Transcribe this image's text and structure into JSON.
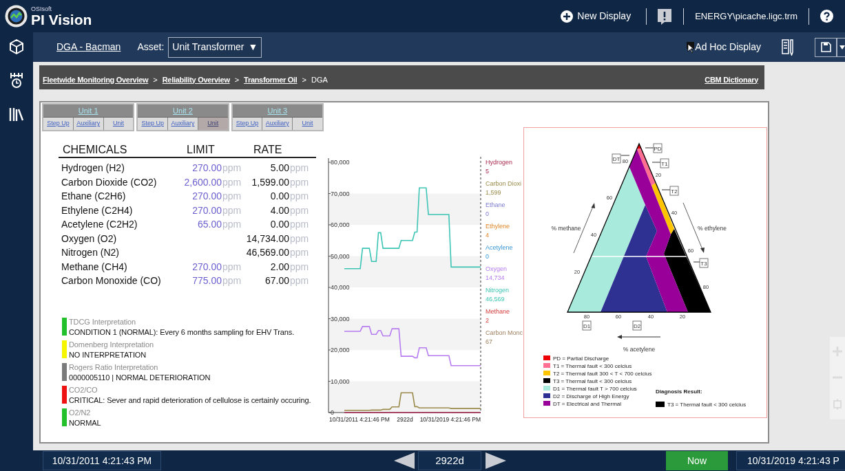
{
  "header": {
    "brand_small": "OSIsoft",
    "brand": "PI Vision",
    "new_display": "New Display",
    "user": "ENERGY\\picache.ligc.trm"
  },
  "toolbar": {
    "display_name": "DGA - Bacman",
    "asset_label": "Asset:",
    "asset_value": "Unit Transformer",
    "asset_caret": "▼",
    "ad_hoc": "Ad Hoc Display"
  },
  "breadcrumb": {
    "items": [
      {
        "kind": "link",
        "text": "Fleetwide Monitoring Overview"
      },
      {
        "kind": "separator",
        "text": ">"
      },
      {
        "kind": "link",
        "text": "Reliability Overview"
      },
      {
        "kind": "separator",
        "text": ">"
      },
      {
        "kind": "link",
        "text": "Transformer Oil"
      },
      {
        "kind": "separator",
        "text": ">"
      },
      {
        "kind": "current",
        "text": "DGA"
      }
    ],
    "dictionary_link": "CBM Dictionary"
  },
  "unit_tabs": [
    {
      "label": "Unit 1",
      "buttons": [
        {
          "label": "Step Up",
          "selected": false
        },
        {
          "label": "Auxiliary",
          "selected": false
        },
        {
          "label": "Unit",
          "selected": false
        }
      ]
    },
    {
      "label": "Unit 2",
      "buttons": [
        {
          "label": "Step Up",
          "selected": false
        },
        {
          "label": "Auxiliary",
          "selected": false
        },
        {
          "label": "Unit",
          "selected": true
        }
      ]
    },
    {
      "label": "Unit 3",
      "buttons": [
        {
          "label": "Step Up",
          "selected": false
        },
        {
          "label": "Auxiliary",
          "selected": false
        },
        {
          "label": "Unit",
          "selected": false
        }
      ]
    }
  ],
  "chemicals": {
    "columns": [
      "CHEMICALS",
      "LIMIT",
      "RATE"
    ],
    "rows": [
      {
        "name": "Hydrogen (H2)",
        "limit": "270.00",
        "limit_unit": "ppm",
        "rate": "5.00",
        "rate_unit": "ppm"
      },
      {
        "name": "Carbon Dioxide (CO2)",
        "limit": "2,600.00",
        "limit_unit": "ppm",
        "rate": "1,599.00",
        "rate_unit": "ppm"
      },
      {
        "name": "Ethane (C2H6)",
        "limit": "270.00",
        "limit_unit": "ppm",
        "rate": "0.00",
        "rate_unit": "ppm"
      },
      {
        "name": "Ethylene (C2H4)",
        "limit": "270.00",
        "limit_unit": "ppm",
        "rate": "4.00",
        "rate_unit": "ppm"
      },
      {
        "name": "Acetylene (C2H2)",
        "limit": "65.00",
        "limit_unit": "ppm",
        "rate": "0.00",
        "rate_unit": "ppm"
      },
      {
        "name": "Oxygen (O2)",
        "rate": "14,734.00",
        "rate_unit": "ppm"
      },
      {
        "name": "Nitrogen (N2)",
        "rate": "46,569.00",
        "rate_unit": "ppm"
      },
      {
        "name": "Methane (CH4)",
        "limit": "270.00",
        "limit_unit": "ppm",
        "rate": "2.00",
        "rate_unit": "ppm"
      },
      {
        "name": "Carbon Monoxide (CO)",
        "limit": "775.00",
        "limit_unit": "ppm",
        "rate": "67.00",
        "rate_unit": "ppm"
      }
    ]
  },
  "interpretations": [
    {
      "title": "TDCG Interpretation",
      "text": "CONDITION 1 (NORMAL): Every 6 months sampling for EHV Trans.",
      "color": "#22c02a"
    },
    {
      "title": "Domenberg Interpretation",
      "text": "NO INTERPRETATION",
      "color": "#f5f500"
    },
    {
      "title": "Rogers Ratio Interpretation",
      "text": "0000005110 | NORMAL DETERIORATION",
      "color": "#7a7a7a"
    },
    {
      "title": "CO2/CO",
      "text": "CRITICAL: Sever and rapid deterioration of cellulose is certainly occuring.",
      "color": "#ee1111"
    },
    {
      "title": "O2/N2",
      "text": "NORMAL",
      "color": "#22c02a"
    }
  ],
  "trend": {
    "chart_data": {
      "type": "line",
      "categories": [
        null,
        null,
        null,
        null,
        null,
        null,
        null,
        null,
        null,
        null,
        null,
        null,
        null,
        null,
        null,
        null,
        null,
        null,
        null,
        null,
        null,
        null,
        null,
        null,
        null,
        null,
        null,
        null,
        null,
        null,
        null,
        null,
        null,
        null,
        null,
        null,
        null,
        null,
        null,
        null,
        null,
        null,
        null,
        null,
        null,
        null,
        null,
        null,
        null,
        null,
        null,
        null,
        null,
        null,
        null,
        null,
        null,
        null,
        null,
        null,
        null
      ],
      "ylim": [
        0,
        80000
      ],
      "yticks": [
        {
          "value": 0,
          "label": "0"
        },
        {
          "value": 10000,
          "label": "10,000"
        },
        {
          "value": 20000,
          "label": "20,000"
        },
        {
          "value": 30000,
          "label": "30,000"
        },
        {
          "value": 40000,
          "label": "40,000"
        },
        {
          "value": 50000,
          "label": "50,000"
        },
        {
          "value": 60000,
          "label": "60,000"
        },
        {
          "value": 70000,
          "label": "70,000"
        },
        {
          "value": 80000,
          "label": "80,000"
        }
      ],
      "series": [
        {
          "name": "Hydrogen",
          "color": "#a8284f",
          "values": [
            5,
            5,
            5,
            5,
            5,
            5,
            5,
            5,
            5,
            5,
            5,
            5,
            5,
            5,
            5,
            5,
            5,
            5,
            5,
            5,
            5,
            5,
            5,
            5,
            5,
            5,
            5,
            5,
            5,
            5,
            5,
            5,
            5,
            5,
            5,
            5,
            5,
            5,
            5,
            5,
            5,
            5,
            5,
            5,
            5,
            5,
            5,
            5,
            5,
            5,
            5,
            5,
            5,
            5,
            5,
            5,
            5,
            5,
            5,
            5,
            5
          ]
        },
        {
          "name": "Carbon Dioxi",
          "color": "#9a8a4a",
          "values": [
            700,
            700,
            700,
            700,
            700,
            700,
            700,
            700,
            700,
            700,
            700,
            700,
            800,
            800,
            800,
            800,
            800,
            1000,
            1000,
            1000,
            1000,
            1800,
            1800,
            1800,
            1800,
            6300,
            6300,
            6300,
            6300,
            6300,
            6300,
            1900,
            1900,
            1500,
            1500,
            1500,
            1500,
            1500,
            1500,
            1500,
            1500,
            1500,
            1500,
            1500,
            1500,
            1500,
            1500,
            1300,
            1300,
            1300,
            1300,
            1300,
            1300,
            1300,
            1300,
            1300,
            1300,
            1300,
            1300,
            1300,
            1300
          ]
        },
        {
          "name": "Ethane",
          "color": "#7b7bd0",
          "values": [
            null,
            null,
            null,
            null,
            null,
            null,
            null,
            null,
            null,
            null,
            null,
            null,
            null,
            null,
            null,
            null,
            null,
            null,
            null,
            null,
            null,
            null,
            null,
            null,
            null,
            null,
            null,
            null,
            null,
            null,
            null,
            null,
            null,
            null,
            null,
            null,
            null,
            null,
            null,
            null,
            null,
            null,
            null,
            null,
            null,
            null,
            null,
            null,
            null,
            null,
            null,
            null,
            null,
            null,
            null,
            null,
            null,
            null,
            null,
            null,
            null
          ]
        },
        {
          "name": "Ethylene",
          "color": "#e0862a",
          "values": [
            null,
            null,
            null,
            null,
            null,
            null,
            null,
            null,
            null,
            null,
            null,
            null,
            null,
            null,
            null,
            null,
            null,
            null,
            null,
            null,
            null,
            null,
            null,
            null,
            null,
            null,
            null,
            null,
            null,
            null,
            null,
            null,
            null,
            null,
            null,
            null,
            null,
            null,
            null,
            null,
            null,
            null,
            null,
            null,
            null,
            null,
            null,
            null,
            null,
            null,
            null,
            null,
            null,
            null,
            null,
            null,
            null,
            null,
            null,
            null,
            null
          ]
        },
        {
          "name": "Acetylene",
          "color": "#3a98d8",
          "values": [
            null,
            null,
            null,
            null,
            null,
            null,
            null,
            null,
            null,
            null,
            null,
            null,
            null,
            null,
            null,
            null,
            null,
            null,
            null,
            null,
            null,
            null,
            null,
            null,
            null,
            null,
            null,
            null,
            null,
            null,
            null,
            null,
            null,
            null,
            null,
            null,
            null,
            null,
            null,
            null,
            null,
            null,
            null,
            null,
            null,
            null,
            null,
            null,
            null,
            null,
            null,
            null,
            null,
            null,
            null,
            null,
            null,
            null,
            null,
            null,
            null
          ]
        },
        {
          "name": "Oxygen",
          "color": "#b67cf0",
          "values": [
            26000,
            26000,
            26000,
            26000,
            26000,
            26000,
            26000,
            26000,
            27500,
            27500,
            27500,
            27500,
            25000,
            25000,
            25000,
            26200,
            26200,
            24500,
            24500,
            24500,
            24500,
            26800,
            26800,
            26800,
            26800,
            18000,
            18000,
            18000,
            18000,
            18000,
            18000,
            17500,
            17500,
            20700,
            20700,
            20700,
            20700,
            18200,
            18200,
            18200,
            18200,
            18200,
            18200,
            18200,
            18200,
            18200,
            18200,
            15000,
            15000,
            15000,
            15000,
            15000,
            15000,
            15000,
            15000,
            15000,
            15000,
            15000,
            15000,
            15000,
            15000
          ]
        },
        {
          "name": "Nitrogen",
          "color": "#3cc4b4",
          "values": [
            46000,
            46000,
            46000,
            46000,
            46000,
            46000,
            46000,
            46000,
            52500,
            52500,
            52500,
            52500,
            48300,
            48300,
            48300,
            57500,
            57500,
            52500,
            52500,
            52500,
            52500,
            52500,
            52500,
            52500,
            52500,
            55000,
            55000,
            55000,
            55000,
            55000,
            55000,
            57700,
            57700,
            71800,
            71800,
            71800,
            71800,
            63300,
            63300,
            63300,
            63300,
            63300,
            63300,
            63300,
            63300,
            63300,
            63300,
            46500,
            46500,
            46500,
            46500,
            46500,
            46500,
            46500,
            46500,
            46500,
            46500,
            46500,
            46500,
            46500,
            46500
          ]
        },
        {
          "name": "Methane",
          "color": "#d63c3c",
          "values": [
            null,
            null,
            null,
            null,
            null,
            null,
            null,
            null,
            null,
            null,
            null,
            null,
            null,
            null,
            null,
            null,
            null,
            null,
            null,
            null,
            null,
            null,
            null,
            null,
            null,
            null,
            null,
            null,
            null,
            null,
            null,
            null,
            null,
            null,
            null,
            null,
            null,
            null,
            null,
            null,
            null,
            null,
            null,
            null,
            null,
            null,
            null,
            null,
            null,
            null,
            null,
            null,
            null,
            null,
            null,
            null,
            null,
            null,
            null,
            null,
            null
          ]
        },
        {
          "name": "Carbon Monc",
          "color": "#a08060",
          "values": [
            null,
            null,
            null,
            null,
            null,
            null,
            null,
            null,
            null,
            null,
            null,
            null,
            null,
            null,
            null,
            null,
            null,
            null,
            null,
            null,
            null,
            null,
            null,
            null,
            null,
            null,
            null,
            null,
            null,
            null,
            null,
            null,
            null,
            null,
            null,
            null,
            null,
            null,
            null,
            null,
            null,
            null,
            null,
            null,
            null,
            null,
            null,
            null,
            null,
            null,
            null,
            null,
            null,
            null,
            null,
            null,
            null,
            null,
            null,
            null,
            null
          ]
        }
      ]
    },
    "start_label": "10/31/2011 4:21:46 PM",
    "duration_label": "2922d",
    "end_label": "10/31/2019 4:21:46 PM",
    "current_values": [
      "5",
      "1,599",
      "0",
      "4",
      "0",
      "14,734",
      "46,569",
      "2",
      "67"
    ]
  },
  "duval": {
    "zone_labels": [
      "PD",
      "T1",
      "T2",
      "DT",
      "T3",
      "D1",
      "D2"
    ],
    "left_ticks": [
      "80",
      "60",
      "40",
      "20"
    ],
    "right_ticks": [
      "20",
      "40",
      "60",
      "80"
    ],
    "bottom_ticks": [
      "80",
      "60",
      "40",
      "20"
    ],
    "methane_axis": "% methane",
    "ethylene_axis": "% ethylene",
    "acetylene_axis": "% acetylene",
    "legend": [
      {
        "text": "PD = Partial Discharge",
        "color": "#ee0000"
      },
      {
        "text": "T1 = Thermal fault < 300 celcius",
        "color": "#ff6f91"
      },
      {
        "text": "T2 = Thermal fault 300 < T < 700 celcius",
        "color": "#ffc400"
      },
      {
        "text": "T3 = Thermal fault < 300 celcius",
        "color": "#000000"
      },
      {
        "text": "D1 = Thermal fault T > 700 celcius",
        "color": "#a8eadc"
      },
      {
        "text": "D2 = Discharge of High Energy",
        "color": "#2e3092"
      },
      {
        "text": "DT = Electrical and Thermal",
        "color": "#990099"
      }
    ],
    "diagnosis_title": "Diagnosis Result:",
    "diagnosis": {
      "text": "T3 = Thermal fault < 300 celcius",
      "color": "#000000"
    }
  },
  "timebar": {
    "start": "10/31/2011 4:21:43 PM",
    "duration": "2922d",
    "now": "Now",
    "end": "10/31/2019 4:21:43 P"
  }
}
